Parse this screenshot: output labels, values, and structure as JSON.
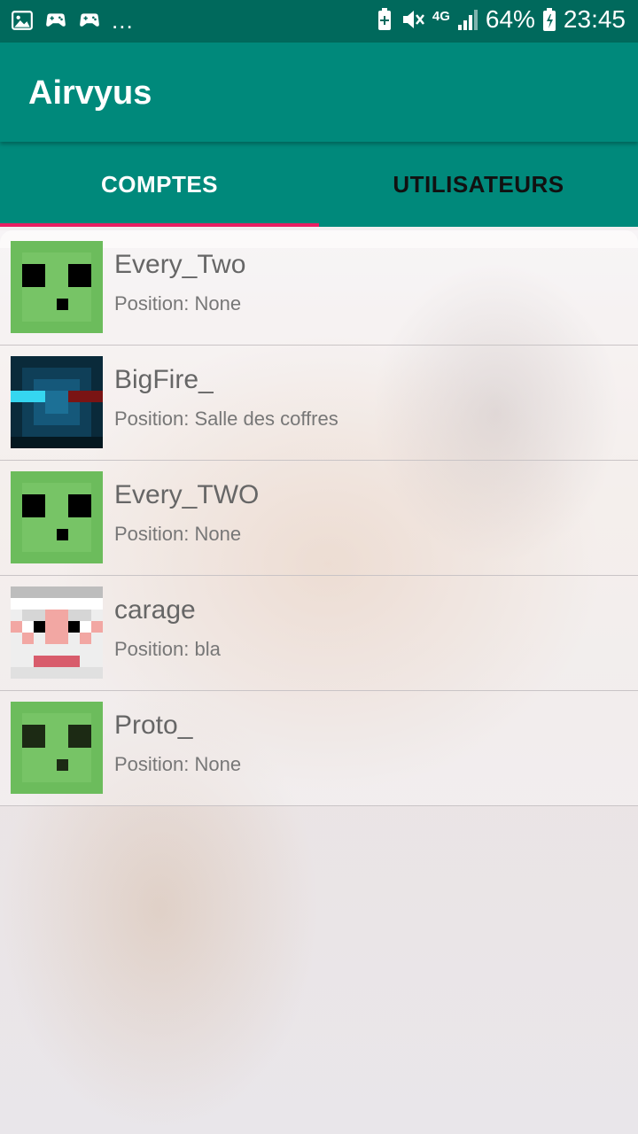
{
  "status_bar": {
    "left_icons": [
      "image-icon",
      "gamepad-icon",
      "gamepad-icon"
    ],
    "overflow": "...",
    "network": "4G",
    "battery": "64%",
    "time": "23:45"
  },
  "app": {
    "title": "Airvyus"
  },
  "tabs": [
    {
      "label": "COMPTES",
      "active": true
    },
    {
      "label": "UTILISATEURS",
      "active": false
    }
  ],
  "accounts": [
    {
      "name": "Every_Two",
      "position": "Position: None",
      "avatar": "slime"
    },
    {
      "name": "BigFire_",
      "position": "Position: Salle des coffres",
      "avatar": "bigfire"
    },
    {
      "name": "Every_TWO",
      "position": "Position: None",
      "avatar": "slime"
    },
    {
      "name": "carage",
      "position": "Position: bla",
      "avatar": "carage"
    },
    {
      "name": "Proto_",
      "position": "Position: None",
      "avatar": "slime-dark"
    }
  ],
  "colors": {
    "status_bar": "#00695c",
    "app_bar": "#00897b",
    "tab_indicator": "#e91e63"
  }
}
